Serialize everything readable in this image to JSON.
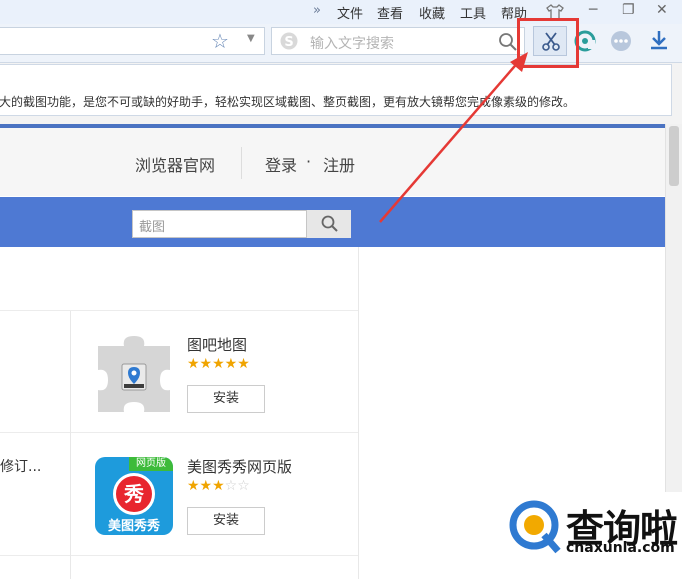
{
  "menubar": {
    "more": "»",
    "items": [
      "文件",
      "查看",
      "收藏",
      "工具",
      "帮助"
    ],
    "window_buttons": [
      "─",
      "❐",
      "✕"
    ]
  },
  "toolbar": {
    "search_placeholder": "输入文字搜索"
  },
  "notice": {
    "text": "大的截图功能，是您不可或缺的好助手，轻松实现区域截图、整页截图，更有放大镜帮您完成像素级的修改。"
  },
  "page_header": {
    "official_site": "浏览器官网",
    "login": "登录",
    "dot": "·",
    "register": "注册"
  },
  "site_search": {
    "value": "截图"
  },
  "apps": [
    {
      "name": "图吧地图",
      "stars_full": 5,
      "stars_total": 5,
      "install_label": "安装"
    },
    {
      "name": "美图秀秀网页版",
      "stars_full": 3,
      "stars_total": 5,
      "install_label": "安装",
      "badge": "网页版",
      "logo_char": "秀",
      "logo_text": "美图秀秀"
    }
  ],
  "left_truncated_text": "修订...",
  "watermark": {
    "text": "查询啦",
    "url": "chaxunla.com"
  },
  "colors": {
    "accent_blue": "#4e79d3",
    "highlight_red": "#e53935",
    "star_gold": "#f0a400"
  }
}
